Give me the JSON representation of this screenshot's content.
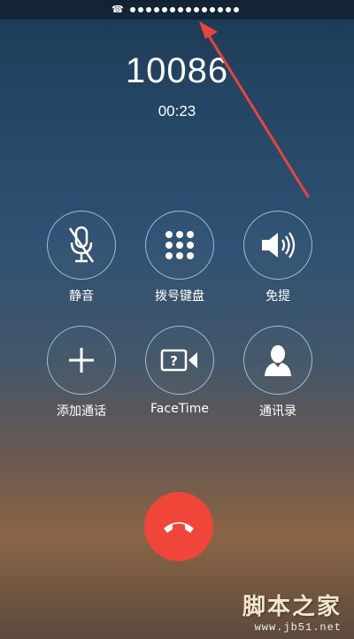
{
  "status_bar": {
    "icon": "phone-icon",
    "dot_count": 14
  },
  "call": {
    "number": "10086",
    "duration": "00:23"
  },
  "controls": [
    {
      "label": "静音",
      "icon": "mute-microphone-icon"
    },
    {
      "label": "拨号键盘",
      "icon": "keypad-icon"
    },
    {
      "label": "免提",
      "icon": "speaker-icon"
    },
    {
      "label": "添加通话",
      "icon": "plus-icon"
    },
    {
      "label": "FaceTime",
      "icon": "facetime-icon"
    },
    {
      "label": "通讯录",
      "icon": "contacts-icon"
    }
  ],
  "end_call": {
    "icon": "hang-up-icon",
    "color": "#f0463a"
  },
  "watermark": {
    "title": "脚本之家",
    "url": "www.jb51.net"
  },
  "colors": {
    "annotation_arrow": "#e8443a",
    "circle_border": "#a0c8eb"
  }
}
